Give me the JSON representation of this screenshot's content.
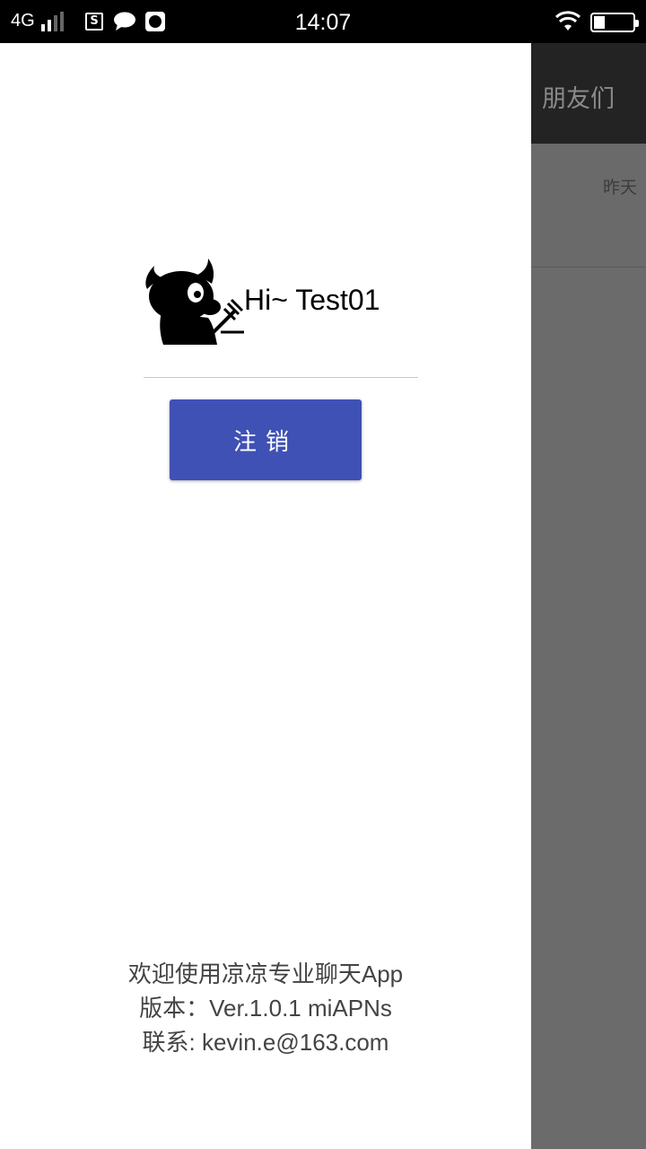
{
  "status_bar": {
    "network": "4G",
    "time": "14:07",
    "icons": [
      "signal-icon",
      "s-app-icon",
      "chat-bubble-icon",
      "camera-app-icon",
      "wifi-icon",
      "battery-icon"
    ]
  },
  "main": {
    "title": "朋友们",
    "rows": [
      {
        "time": "昨天"
      }
    ]
  },
  "drawer": {
    "greeting": "Hi~ Test01",
    "logout_label": "注销",
    "footer": {
      "welcome": "欢迎使用凉凉专业聊天App",
      "version": "版本：Ver.1.0.1 miAPNs",
      "contact": "联系: kevin.e@163.com"
    }
  },
  "colors": {
    "primary": "#3f51b5",
    "scrim": "#6b6b6b",
    "toolbar": "#232323"
  }
}
